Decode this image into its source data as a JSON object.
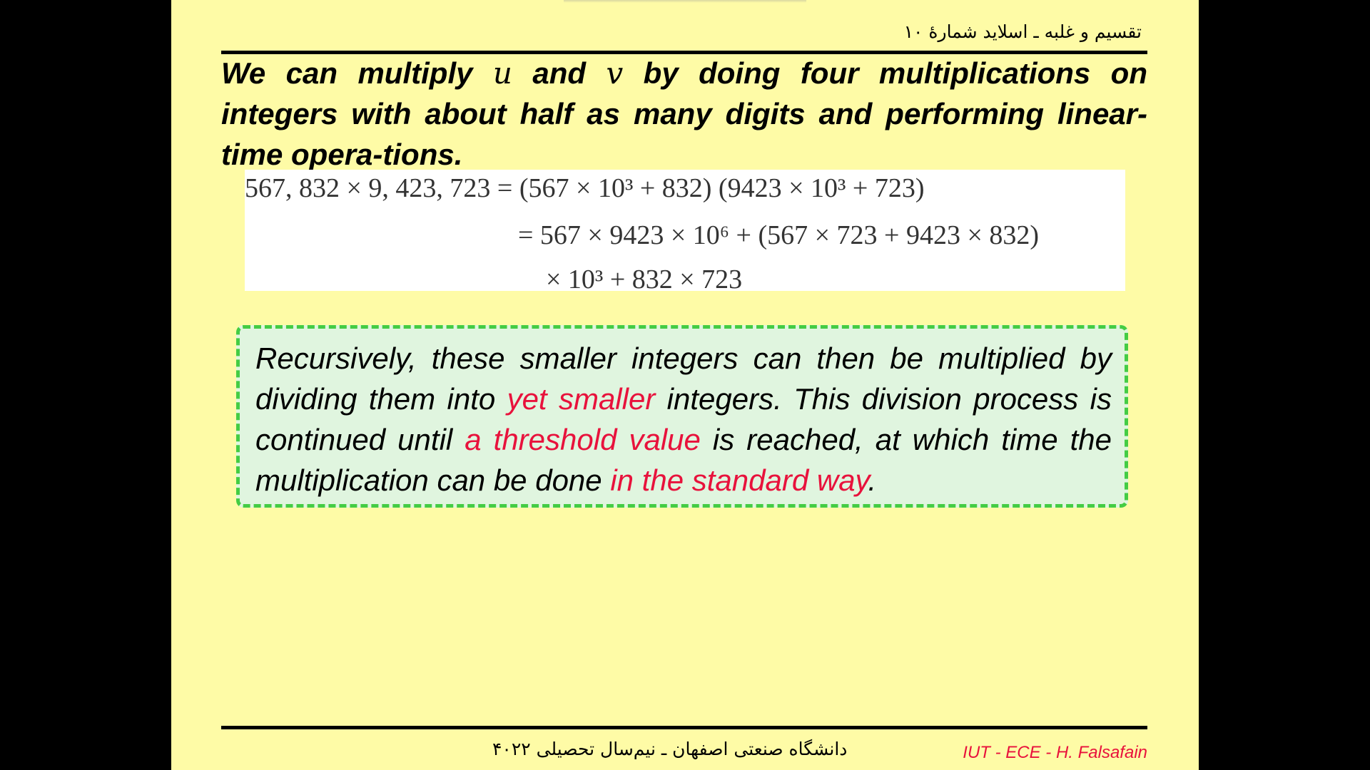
{
  "header": {
    "title": "تقسیم و غلبه ـ اسلاید شمارهٔ ۱۰"
  },
  "intro": {
    "part1": "We can multiply ",
    "var_u": "u",
    "part2": " and ",
    "var_v": "v",
    "part3": " by doing four multiplications on integers with about half as many digits and performing linear-time opera-tions."
  },
  "equation": {
    "line1": "567, 832 × 9, 423, 723 = (567 × 10³ + 832) (9423 × 10³ + 723)",
    "line2": "= 567 × 9423 × 10⁶ + (567 × 723 + 9423 × 832)",
    "line3": "× 10³ + 832 × 723"
  },
  "box": {
    "t1": "Recursively, these smaller integers can then be multiplied by dividing them into ",
    "h1": "yet smaller",
    "t2": " integers.  This division process is continued until ",
    "h2": "a threshold value",
    "t3": " is reached, at which time the multiplication can be done ",
    "h3": "in the standard way",
    "t4": "."
  },
  "footer": {
    "university": "دانشگاه صنعتی اصفهان ـ نیم‌سال تحصیلی ۴۰۲۲",
    "author": "IUT - ECE - H. Falsafain"
  },
  "colors": {
    "background": "#fefba6",
    "highlight": "#e8123c",
    "box_border": "#44cc44",
    "box_fill": "#e0f5df"
  }
}
